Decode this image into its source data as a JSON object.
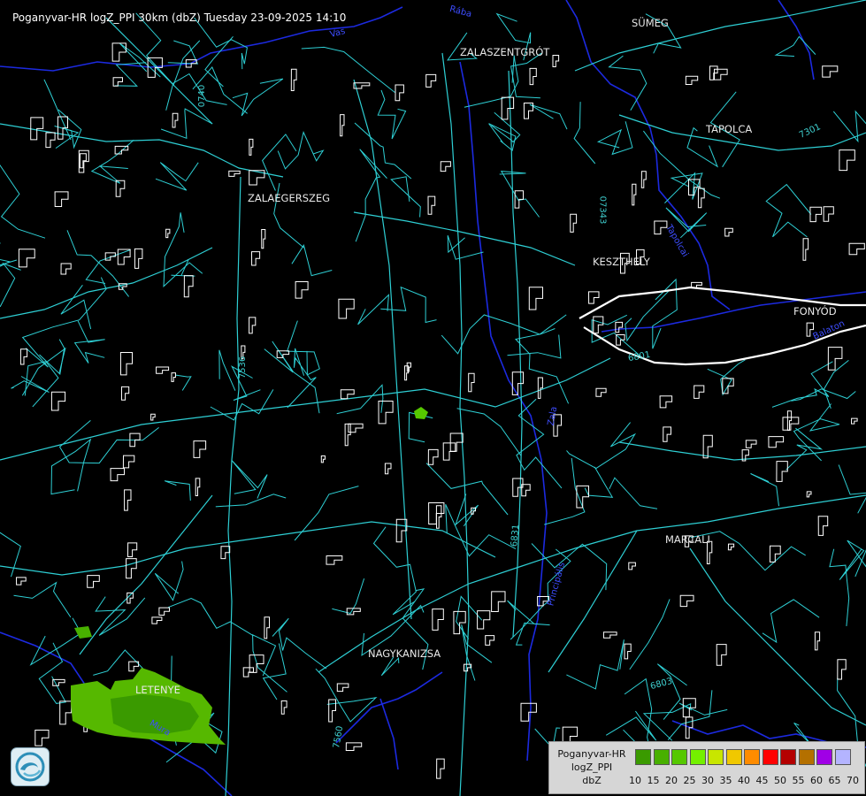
{
  "header": {
    "title": "Poganyvar-HR logZ_PPI 30km (dbZ) Tuesday 23-09-2025 14:10"
  },
  "towns": {
    "sumeg": "SÜMEG",
    "zalaszentgrot": "ZALASZENTGRÓT",
    "tapolca": "TAPOLCA",
    "zalaegerszeg": "ZALAEGERSZEG",
    "keszthely": "KESZTHELY",
    "fonyod": "FONYÓD",
    "marcali": "MARCALI",
    "nagykanizsa": "NAGYKANIZSA",
    "letenye": "LETENYE"
  },
  "road_labels": {
    "r0740": "0740",
    "r07343": "07343",
    "r7301": "7301",
    "r6801": "6801",
    "r7536": "7536",
    "r6831": "6831",
    "r6803": "6803",
    "r7560": "7560"
  },
  "water_labels": {
    "vas": "Vas",
    "zala": "Zala",
    "balaton": "Balaton",
    "tapolcai": "Tapolcai",
    "principalis": "Principális",
    "mura": "Mura",
    "raba": "Rába"
  },
  "legend": {
    "name_line1": "Poganyvar-HR",
    "name_line2": "logZ_PPI",
    "name_line3": "dbZ",
    "colors": [
      "#3a9a00",
      "#48b000",
      "#56c800",
      "#74f000",
      "#c8e600",
      "#f0c800",
      "#ff8c00",
      "#ff0000",
      "#b40000",
      "#b47000",
      "#a000e6",
      "#b4b4ff"
    ],
    "ticks": [
      "10",
      "15",
      "20",
      "25",
      "30",
      "35",
      "40",
      "45",
      "50",
      "55",
      "60",
      "65",
      "70"
    ]
  },
  "logo": {
    "icon": "weather-service-logo-icon"
  }
}
